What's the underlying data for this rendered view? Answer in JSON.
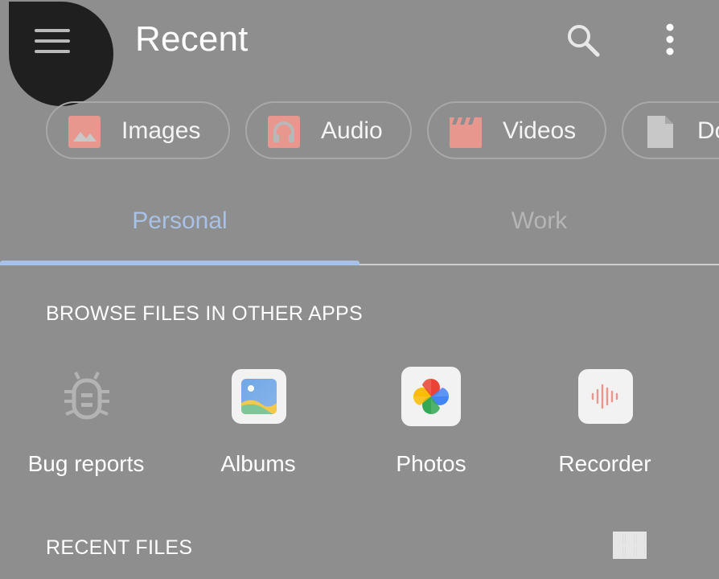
{
  "header": {
    "title": "Recent",
    "menu_icon": "hamburger-menu-icon",
    "search_icon": "search-icon",
    "more_icon": "more-vertical-icon"
  },
  "chips": [
    {
      "label": "Images",
      "icon": "image-icon"
    },
    {
      "label": "Audio",
      "icon": "headphones-icon"
    },
    {
      "label": "Videos",
      "icon": "movie-icon"
    },
    {
      "label": "Do",
      "icon": "document-icon"
    }
  ],
  "tabs": [
    {
      "label": "Personal",
      "selected": true
    },
    {
      "label": "Work",
      "selected": false
    }
  ],
  "browse_section": {
    "heading": "BROWSE FILES IN OTHER APPS",
    "apps": [
      {
        "label": "Bug reports",
        "icon": "bug-icon"
      },
      {
        "label": "Albums",
        "icon": "albums-icon"
      },
      {
        "label": "Photos",
        "icon": "photos-pinwheel-icon"
      },
      {
        "label": "Recorder",
        "icon": "recorder-waveform-icon"
      }
    ]
  },
  "recent_section": {
    "heading": "RECENT FILES",
    "view_toggle_icon": "grid-view-icon"
  },
  "colors": {
    "scrim_background": "#8e8e8e",
    "tab_selected": "#a8c1e6",
    "chip_icon": "#e8978f",
    "menu_highlight": "#1f1f20"
  }
}
